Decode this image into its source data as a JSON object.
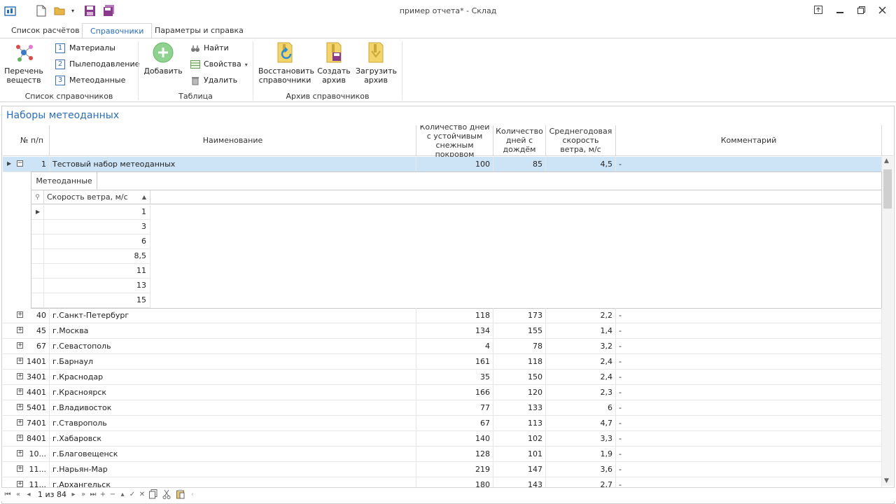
{
  "window": {
    "title": "пример отчета* - Склад"
  },
  "ribbon": {
    "tabs": [
      {
        "label": "Список расчётов",
        "active": false
      },
      {
        "label": "Справочники",
        "active": true
      },
      {
        "label": "Параметры и справка",
        "active": false
      }
    ],
    "groups": {
      "directories": {
        "label": "Список справочников",
        "substances": "Перечень\nвеществ",
        "items": [
          {
            "num": "1",
            "label": "Материалы"
          },
          {
            "num": "2",
            "label": "Пылеподавление"
          },
          {
            "num": "3",
            "label": "Метеоданные"
          }
        ]
      },
      "table": {
        "label": "Таблица",
        "add": "Добавить",
        "find": "Найти",
        "properties": "Свойства",
        "delete": "Удалить"
      },
      "archive": {
        "label": "Архив справочников",
        "restore": "Восстановить\nсправочники",
        "create": "Создать\nархив",
        "load": "Загрузить\nархив"
      }
    }
  },
  "panel": {
    "title": "Наборы метеоданных"
  },
  "grid": {
    "columns": {
      "num": "№ п/п",
      "name": "Наименование",
      "snow_days": "Количество дней с устойчивым снежным покровом",
      "rain_days": "Количество дней с дождём",
      "wind": "Среднегодовая скорость ветра, м/с",
      "comment": "Комментарий"
    },
    "expanded_row": {
      "num": "1",
      "name": "Тестовый набор метеоданных",
      "snow": "100",
      "rain": "85",
      "wind": "4,5",
      "comment": "-"
    },
    "detail": {
      "tab": "Метеоданные",
      "column": "Скорость ветра, м/с",
      "values": [
        "1",
        "3",
        "6",
        "8,5",
        "11",
        "13",
        "15"
      ]
    },
    "rows": [
      {
        "num": "40",
        "name": "г.Санкт-Петербург",
        "snow": "118",
        "rain": "173",
        "wind": "2,2",
        "comment": "-"
      },
      {
        "num": "45",
        "name": "г.Москва",
        "snow": "134",
        "rain": "155",
        "wind": "1,4",
        "comment": "-"
      },
      {
        "num": "67",
        "name": "г.Севастополь",
        "snow": "4",
        "rain": "78",
        "wind": "3,2",
        "comment": "-"
      },
      {
        "num": "1401",
        "name": "г.Барнаул",
        "snow": "161",
        "rain": "118",
        "wind": "2,4",
        "comment": "-"
      },
      {
        "num": "3401",
        "name": "г.Краснодар",
        "snow": "35",
        "rain": "150",
        "wind": "2,4",
        "comment": "-"
      },
      {
        "num": "4401",
        "name": "г.Красноярск",
        "snow": "166",
        "rain": "120",
        "wind": "2,3",
        "comment": "-"
      },
      {
        "num": "5401",
        "name": "г.Владивосток",
        "snow": "77",
        "rain": "133",
        "wind": "6",
        "comment": "-"
      },
      {
        "num": "7401",
        "name": "г.Ставрополь",
        "snow": "67",
        "rain": "113",
        "wind": "4,7",
        "comment": "-"
      },
      {
        "num": "8401",
        "name": "г.Хабаровск",
        "snow": "140",
        "rain": "102",
        "wind": "3,3",
        "comment": "-"
      },
      {
        "num": "10...",
        "name": "г.Благовещенск",
        "snow": "128",
        "rain": "101",
        "wind": "1,9",
        "comment": "-"
      },
      {
        "num": "11...",
        "name": "г.Нарьян-Мар",
        "snow": "219",
        "rain": "147",
        "wind": "3,6",
        "comment": "-"
      },
      {
        "num": "11...",
        "name": "г.Архангельск",
        "snow": "180",
        "rain": "143",
        "wind": "2,7",
        "comment": "-"
      }
    ]
  },
  "navigator": {
    "position": "1 из 84"
  },
  "colors": {
    "accent": "#2b6db7",
    "selected_row": "#cde4f7"
  }
}
